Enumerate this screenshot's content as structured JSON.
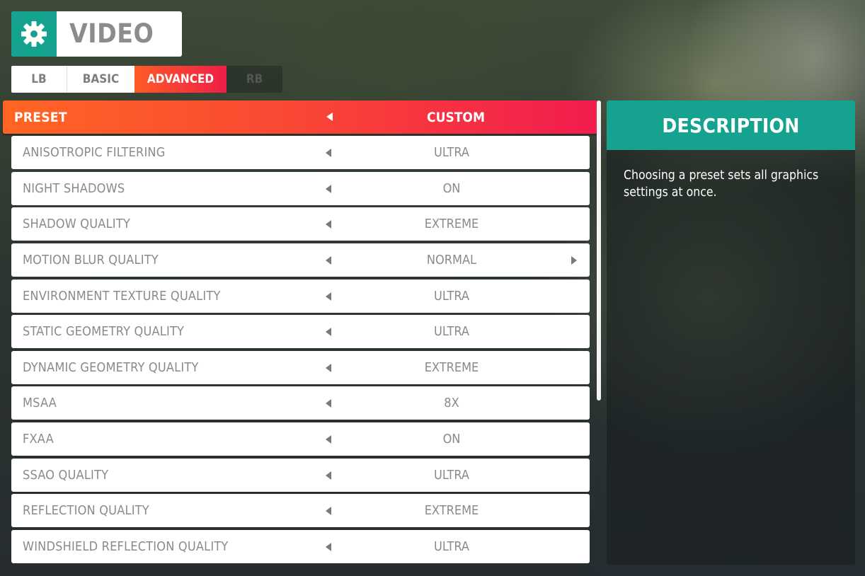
{
  "header": {
    "title": "VIDEO",
    "icon": "gear-icon",
    "accent_color": "#15a38f"
  },
  "tabs": [
    {
      "label": "LB",
      "active": false
    },
    {
      "label": "BASIC",
      "active": false
    },
    {
      "label": "ADVANCED",
      "active": true
    },
    {
      "label": "RB",
      "active": false
    }
  ],
  "preset": {
    "label": "PRESET",
    "value": "CUSTOM"
  },
  "settings": [
    {
      "label": "ANISOTROPIC FILTERING",
      "value": "ULTRA"
    },
    {
      "label": "NIGHT SHADOWS",
      "value": "ON"
    },
    {
      "label": "SHADOW QUALITY",
      "value": "EXTREME"
    },
    {
      "label": "MOTION BLUR QUALITY",
      "value": "NORMAL"
    },
    {
      "label": "ENVIRONMENT TEXTURE QUALITY",
      "value": "ULTRA"
    },
    {
      "label": "STATIC GEOMETRY QUALITY",
      "value": "ULTRA"
    },
    {
      "label": "DYNAMIC GEOMETRY QUALITY",
      "value": "EXTREME"
    },
    {
      "label": "MSAA",
      "value": "8X"
    },
    {
      "label": "FXAA",
      "value": "ON"
    },
    {
      "label": "SSAO QUALITY",
      "value": "ULTRA"
    },
    {
      "label": "REFLECTION QUALITY",
      "value": "EXTREME"
    },
    {
      "label": "WINDSHIELD REFLECTION QUALITY",
      "value": "ULTRA"
    }
  ],
  "description": {
    "title": "DESCRIPTION",
    "text": "Choosing a preset sets all graphics settings at once."
  },
  "colors": {
    "preset_gradient_start": "#ff6523",
    "preset_gradient_end": "#f21c4f",
    "teal": "#15a38f"
  }
}
